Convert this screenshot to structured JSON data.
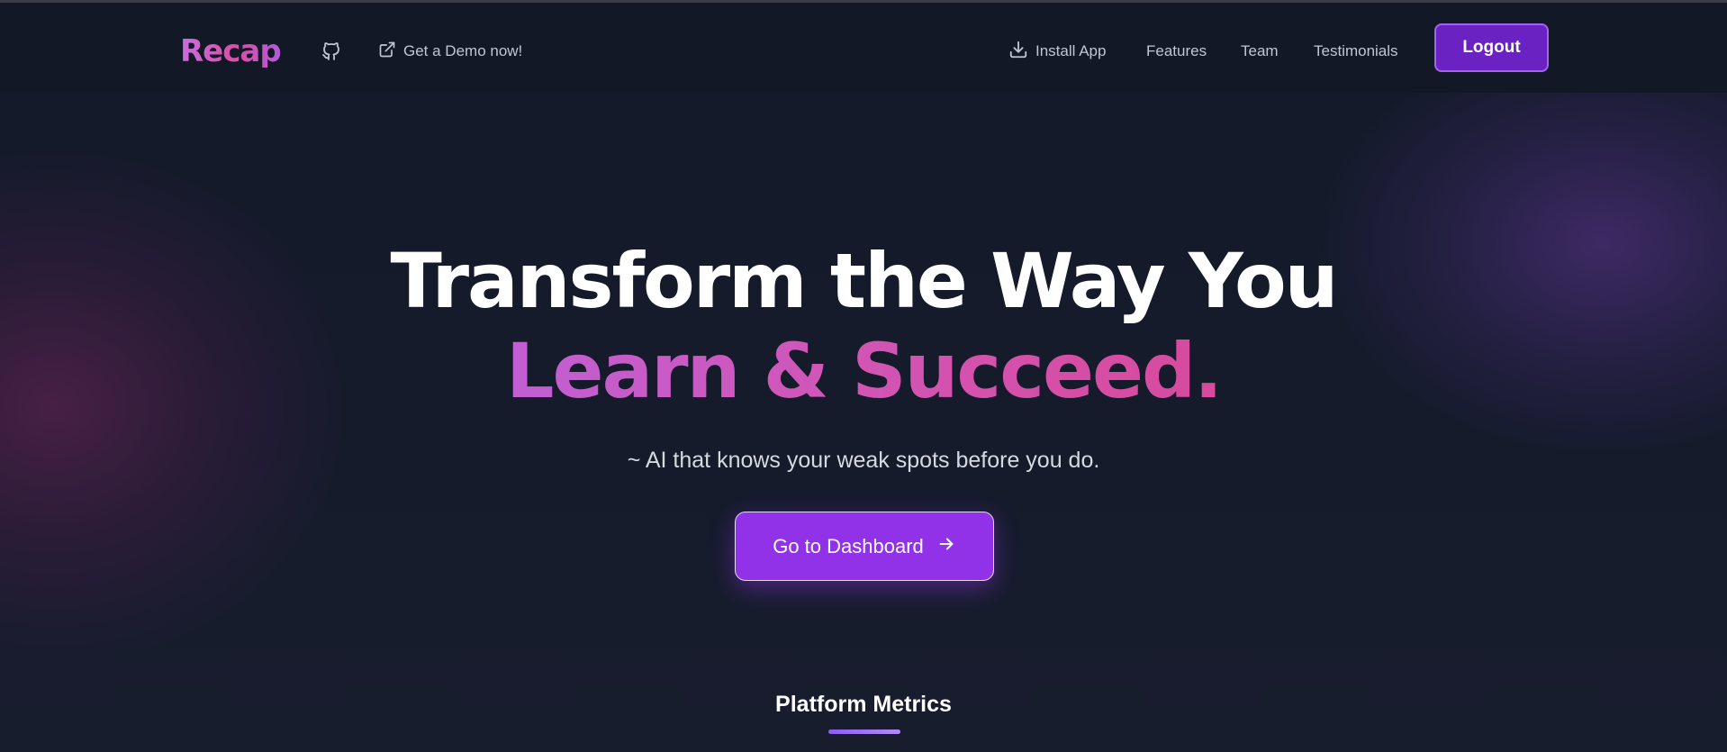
{
  "nav": {
    "brand": "Recap",
    "github_icon": "github-icon",
    "demo_icon": "external-link-icon",
    "demo_label": "Get a Demo now!",
    "install_icon": "download-icon",
    "install_label": "Install App",
    "features_label": "Features",
    "team_label": "Team",
    "testimonials_label": "Testimonials",
    "logout_label": "Logout"
  },
  "hero": {
    "headline_line1": "Transform the Way You",
    "headline_line2": "Learn & Succeed.",
    "tagline": "~ AI that knows your weak spots before you do.",
    "cta_label": "Go to Dashboard",
    "cta_icon": "arrow-right-icon"
  },
  "metrics": {
    "title": "Platform Metrics"
  },
  "colors": {
    "background": "#161b2b",
    "navbar": "#121826",
    "accent_purple": "#9131e8",
    "logout_bg": "#6a22c2",
    "gradient_pink": "#d74a9c"
  }
}
